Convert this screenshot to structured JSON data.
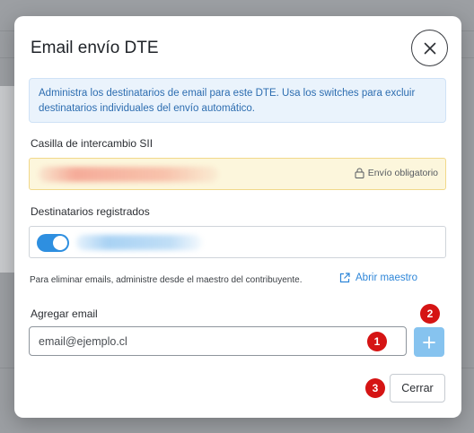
{
  "modal": {
    "title": "Email envío DTE",
    "close_icon": "close-icon"
  },
  "info": {
    "text": "Administra los destinatarios de email para este DTE. Usa los switches para excluir destinatarios individuales del envío automático."
  },
  "sii": {
    "label": "Casilla de intercambio SII",
    "mandatory_label": "Envío obligatorio",
    "icon": "lock-icon"
  },
  "recipients": {
    "label": "Destinatarios registrados",
    "toggle_on": true
  },
  "hint": {
    "text": "Para eliminar emails, administre desde el maestro del contribuyente.",
    "link_label": "Abrir maestro",
    "link_icon": "external-link-icon"
  },
  "add_email": {
    "label": "Agregar email",
    "placeholder": "email@ejemplo.cl",
    "add_icon": "plus-icon"
  },
  "footer": {
    "close_label": "Cerrar"
  },
  "markers": [
    "1",
    "2",
    "3"
  ],
  "colors": {
    "accent": "#2e8fe0",
    "info_bg": "#eaf3fc",
    "warning_bg": "#fcf6dc",
    "marker": "#d51414"
  }
}
